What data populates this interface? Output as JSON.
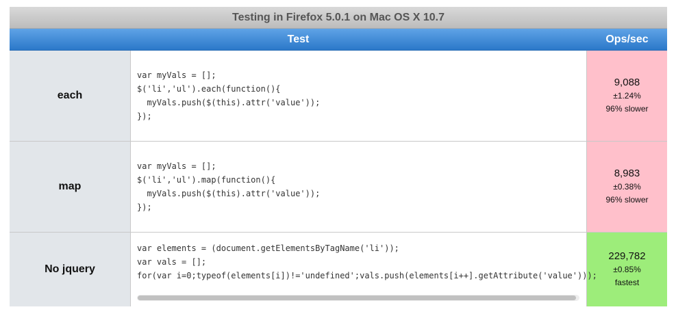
{
  "caption": "Testing in Firefox 5.0.1 on Mac OS X 10.7",
  "columns": {
    "test": "Test",
    "ops": "Ops/sec"
  },
  "rows": [
    {
      "name": "each",
      "code": [
        "var myVals = [];",
        "$('li','ul').each(function(){",
        "  myVals.push($(this).attr('value'));",
        "});"
      ],
      "ops": {
        "value": "9,088",
        "error": "±1.24%",
        "relative": "96% slower",
        "status": "slower"
      }
    },
    {
      "name": "map",
      "code": [
        "var myVals = [];",
        "$('li','ul').map(function(){",
        "  myVals.push($(this).attr('value'));",
        "});"
      ],
      "ops": {
        "value": "8,983",
        "error": "±0.38%",
        "relative": "96% slower",
        "status": "slower"
      }
    },
    {
      "name": "No jquery",
      "code": [
        "var elements = (document.getElementsByTagName('li'));",
        "var vals = [];",
        "for(var i=0;typeof(elements[i])!='undefined';vals.push(elements[i++].getAttribute('value')));"
      ],
      "ops": {
        "value": "229,782",
        "error": "±0.85%",
        "relative": "fastest",
        "status": "fastest"
      }
    }
  ],
  "colors": {
    "slower": "#ffc0cb",
    "fastest": "#9ded7a",
    "header": "#3b89d8"
  }
}
